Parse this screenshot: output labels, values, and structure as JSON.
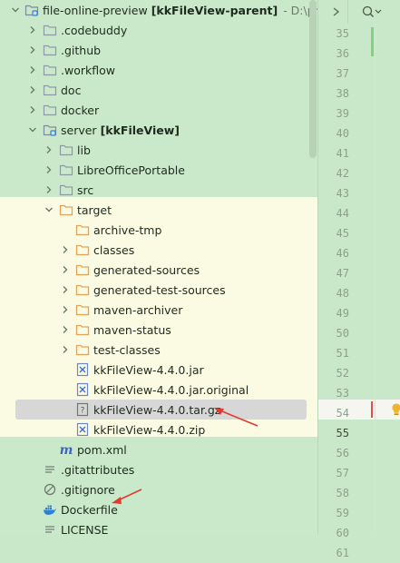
{
  "project": {
    "name": "file-online-preview",
    "module": "[kkFileView-parent]",
    "path": "- D:\\projec"
  },
  "tree": [
    {
      "id": "codebuddy",
      "label": ".codebuddy",
      "depth": 1,
      "chev": "right",
      "icon": "folder-icon"
    },
    {
      "id": "github",
      "label": ".github",
      "depth": 1,
      "chev": "right",
      "icon": "folder-icon"
    },
    {
      "id": "workflow",
      "label": ".workflow",
      "depth": 1,
      "chev": "right",
      "icon": "folder-icon"
    },
    {
      "id": "doc",
      "label": "doc",
      "depth": 1,
      "chev": "right",
      "icon": "folder-icon"
    },
    {
      "id": "docker",
      "label": "docker",
      "depth": 1,
      "chev": "right",
      "icon": "folder-icon"
    },
    {
      "id": "server",
      "label": "server",
      "module": "[kkFileView]",
      "depth": 1,
      "chev": "down",
      "icon": "module-folder-icon"
    },
    {
      "id": "lib",
      "label": "lib",
      "depth": 2,
      "chev": "right",
      "icon": "folder-icon"
    },
    {
      "id": "libreoffice",
      "label": "LibreOfficePortable",
      "depth": 2,
      "chev": "right",
      "icon": "folder-icon"
    },
    {
      "id": "src",
      "label": "src",
      "depth": 2,
      "chev": "right",
      "icon": "folder-icon"
    },
    {
      "id": "target",
      "label": "target",
      "depth": 2,
      "chev": "down",
      "icon": "excluded-folder-icon"
    },
    {
      "id": "archive-tmp",
      "label": "archive-tmp",
      "depth": 3,
      "chev": "none",
      "icon": "excluded-folder-icon"
    },
    {
      "id": "classes",
      "label": "classes",
      "depth": 3,
      "chev": "right",
      "icon": "excluded-folder-icon"
    },
    {
      "id": "generated-sources",
      "label": "generated-sources",
      "depth": 3,
      "chev": "right",
      "icon": "excluded-folder-icon"
    },
    {
      "id": "generated-test-sources",
      "label": "generated-test-sources",
      "depth": 3,
      "chev": "right",
      "icon": "excluded-folder-icon"
    },
    {
      "id": "maven-archiver",
      "label": "maven-archiver",
      "depth": 3,
      "chev": "right",
      "icon": "excluded-folder-icon"
    },
    {
      "id": "maven-status",
      "label": "maven-status",
      "depth": 3,
      "chev": "right",
      "icon": "excluded-folder-icon"
    },
    {
      "id": "test-classes",
      "label": "test-classes",
      "depth": 3,
      "chev": "right",
      "icon": "excluded-folder-icon"
    },
    {
      "id": "jar",
      "label": "kkFileView-4.4.0.jar",
      "depth": 3,
      "chev": "none",
      "icon": "archive-file-icon"
    },
    {
      "id": "jar-original",
      "label": "kkFileView-4.4.0.jar.original",
      "depth": 3,
      "chev": "none",
      "icon": "archive-file-icon"
    },
    {
      "id": "tar-gz",
      "label": "kkFileView-4.4.0.tar.gz",
      "depth": 3,
      "chev": "none",
      "icon": "unknown-file-icon",
      "selected": true
    },
    {
      "id": "zip",
      "label": "kkFileView-4.4.0.zip",
      "depth": 3,
      "chev": "none",
      "icon": "archive-file-icon"
    },
    {
      "id": "pom",
      "label": "pom.xml",
      "depth": 2,
      "chev": "none",
      "icon": "maven-icon"
    },
    {
      "id": "gitattributes",
      "label": ".gitattributes",
      "depth": 1,
      "chev": "none",
      "icon": "text-file-icon"
    },
    {
      "id": "gitignore",
      "label": ".gitignore",
      "depth": 1,
      "chev": "none",
      "icon": "ignore-file-icon"
    },
    {
      "id": "dockerfile",
      "label": "Dockerfile",
      "depth": 1,
      "chev": "none",
      "icon": "docker-icon"
    },
    {
      "id": "license",
      "label": "LICENSE",
      "depth": 1,
      "chev": "none",
      "icon": "text-file-icon"
    }
  ],
  "gutter": {
    "lines": [
      "35",
      "36",
      "37",
      "38",
      "39",
      "40",
      "41",
      "42",
      "43",
      "44",
      "45",
      "46",
      "47",
      "48",
      "49",
      "50",
      "51",
      "52",
      "53",
      "54",
      "55",
      "56",
      "57",
      "58",
      "59",
      "60",
      "61"
    ],
    "current_line": "55"
  },
  "colors": {
    "tree_bg": "#cae9cb",
    "excluded_bg": "#fbfbe4",
    "selection": "#d7d7d7",
    "folder": "#8d9aa6",
    "excluded_folder": "#e1a35a",
    "annotation_arrow": "#e23b2e"
  }
}
